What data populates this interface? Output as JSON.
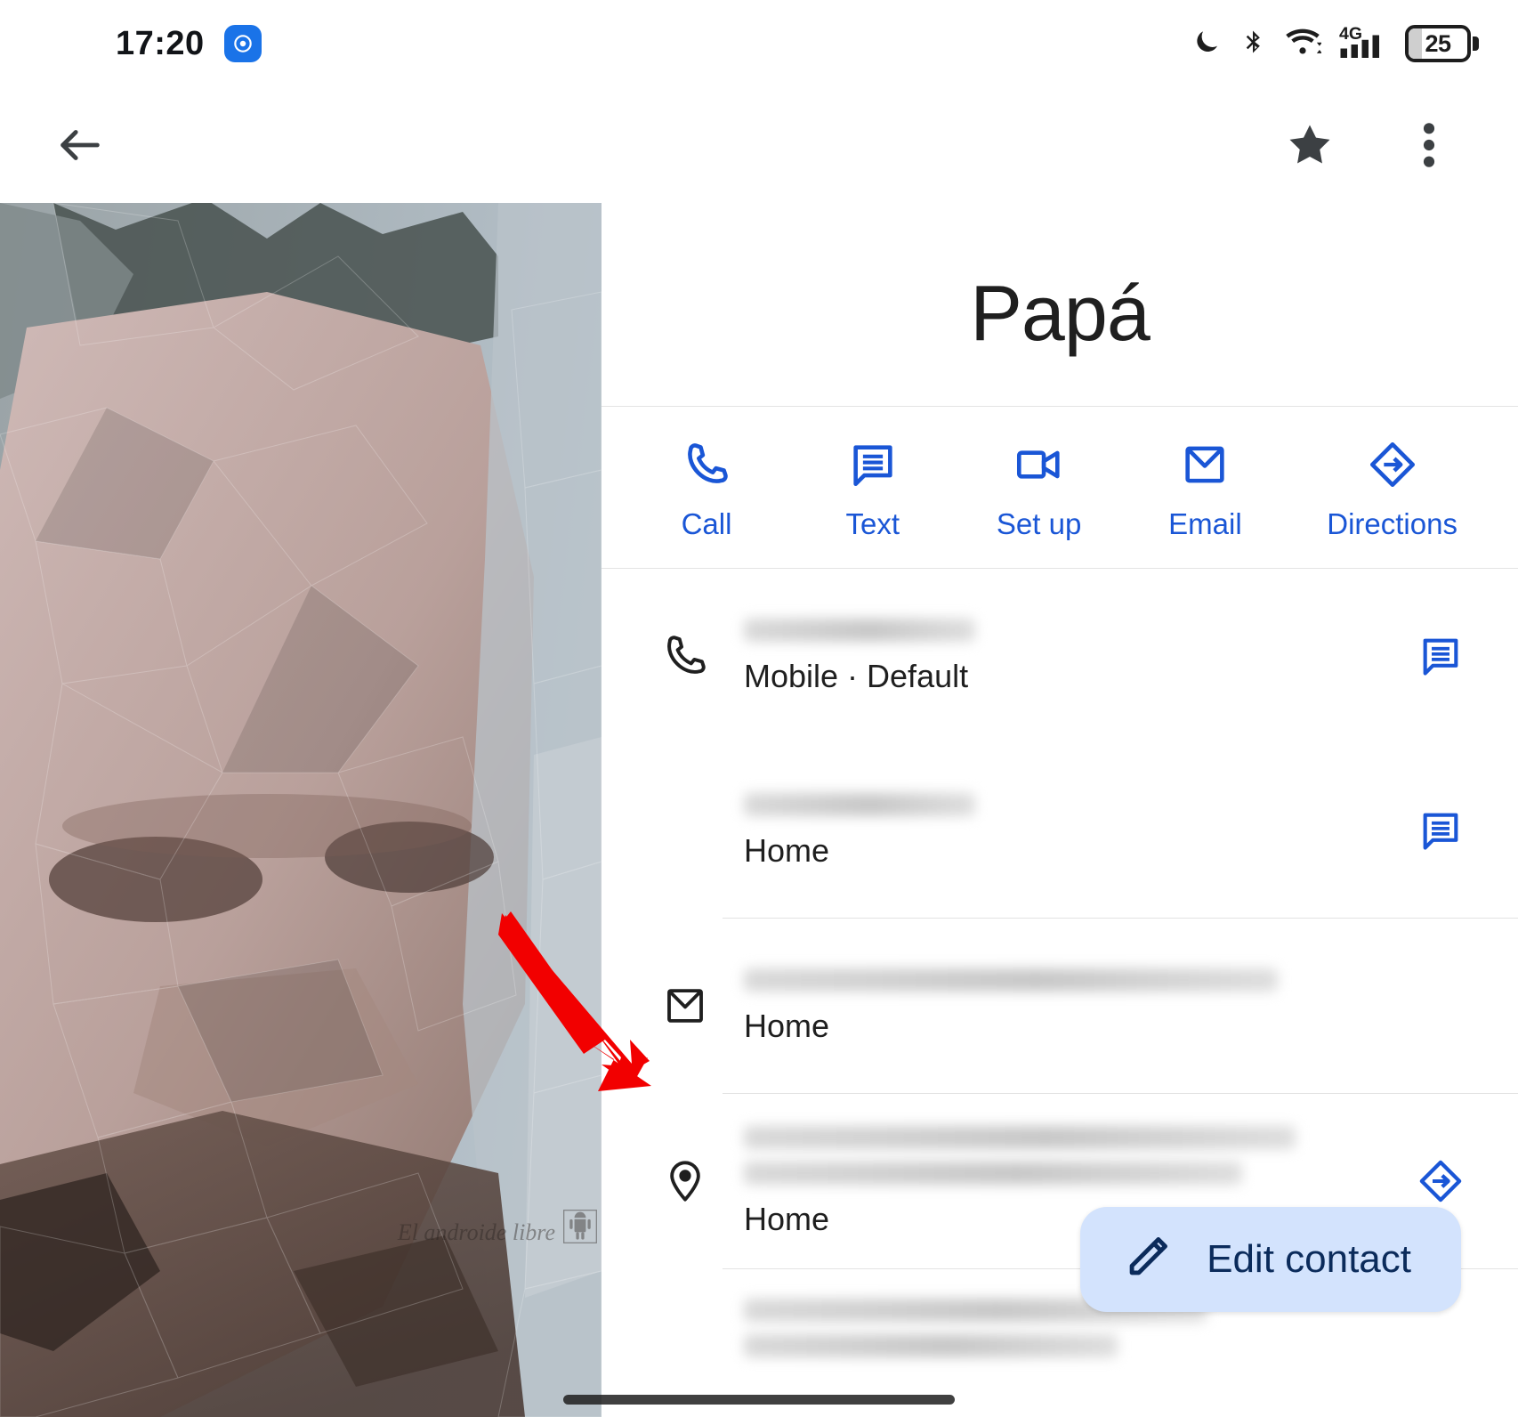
{
  "status_bar": {
    "time": "17:20",
    "app_badge_icon": "camera-app-icon",
    "icons": [
      "dnd-moon-icon",
      "bluetooth-icon",
      "wifi-icon",
      "signal-4g-icon"
    ],
    "network_label": "4G",
    "battery_level": "25"
  },
  "app_bar": {
    "back_icon": "back-arrow-icon",
    "star_icon": "star-filled-icon",
    "overflow_icon": "overflow-menu-icon"
  },
  "photo": {
    "watermark_text": "El androide libre",
    "watermark_logo": "android-robot-icon"
  },
  "contact": {
    "name": "Papá"
  },
  "quick_actions": [
    {
      "label": "Call",
      "icon": "phone-icon"
    },
    {
      "label": "Text",
      "icon": "message-icon"
    },
    {
      "label": "Set up",
      "icon": "video-camera-icon"
    },
    {
      "label": "Email",
      "icon": "envelope-icon"
    },
    {
      "label": "Directions",
      "icon": "directions-icon"
    }
  ],
  "detail_rows": [
    {
      "leading_icon": "phone-icon",
      "value": "",
      "value_redacted": true,
      "subtitle": "Mobile · Default",
      "trailing_icon": "message-icon"
    },
    {
      "leading_icon": "",
      "value": "",
      "value_redacted": true,
      "subtitle": "Home",
      "trailing_icon": "message-icon"
    },
    {
      "leading_icon": "envelope-icon",
      "value": "",
      "value_redacted": true,
      "subtitle": "Home",
      "trailing_icon": ""
    },
    {
      "leading_icon": "location-pin-icon",
      "value": "",
      "value_redacted": true,
      "subtitle": "Home",
      "trailing_icon": "directions-icon"
    }
  ],
  "fab": {
    "label": "Edit contact",
    "icon": "pencil-icon"
  },
  "annotation": {
    "type": "red-arrow",
    "color": "#f20000"
  },
  "colors": {
    "accent_blue": "#1a56d6",
    "fab_background": "#d3e3fd",
    "fab_text": "#0b2b5b",
    "text_primary": "#1f1f1f",
    "divider": "#e3e3e3",
    "status_badge": "#1a73e8"
  }
}
